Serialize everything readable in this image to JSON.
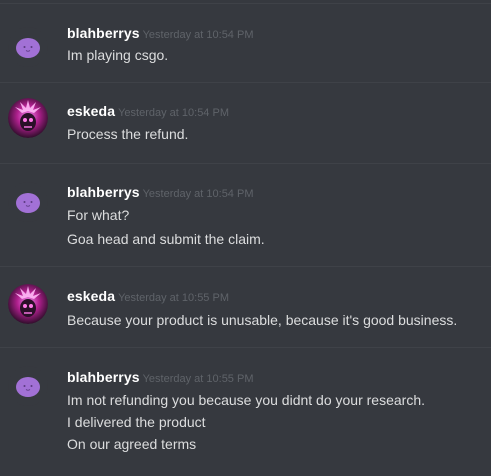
{
  "messages": [
    {
      "author": "blahberrys",
      "avatar": "purple-blob-avatar",
      "timestamp": "Yesterday at 10:54 PM",
      "lines": [
        "Im playing csgo."
      ]
    },
    {
      "author": "eskeda",
      "avatar": "pink-skull-avatar",
      "timestamp": "Yesterday at 10:54 PM",
      "lines": [
        "Process the refund."
      ]
    },
    {
      "author": "blahberrys",
      "avatar": "purple-blob-avatar",
      "timestamp": "Yesterday at 10:54 PM",
      "lines": [
        "For what?",
        "Goa head and submit the claim."
      ]
    },
    {
      "author": "eskeda",
      "avatar": "pink-skull-avatar",
      "timestamp": "Yesterday at 10:55 PM",
      "lines": [
        "Because your product is unusable, because it's good business."
      ]
    },
    {
      "author": "blahberrys",
      "avatar": "purple-blob-avatar",
      "timestamp": "Yesterday at 10:55 PM",
      "lines": [
        "Im not refunding you because you didnt do your research.",
        "I delivered the product",
        "On our agreed terms"
      ]
    }
  ],
  "colors": {
    "background": "#36393f",
    "username": "#ffffff",
    "timestamp": "#5f6369",
    "message_text": "#dcddde",
    "blob_avatar": "#a271d6",
    "skull_glow": "#e040c8"
  }
}
